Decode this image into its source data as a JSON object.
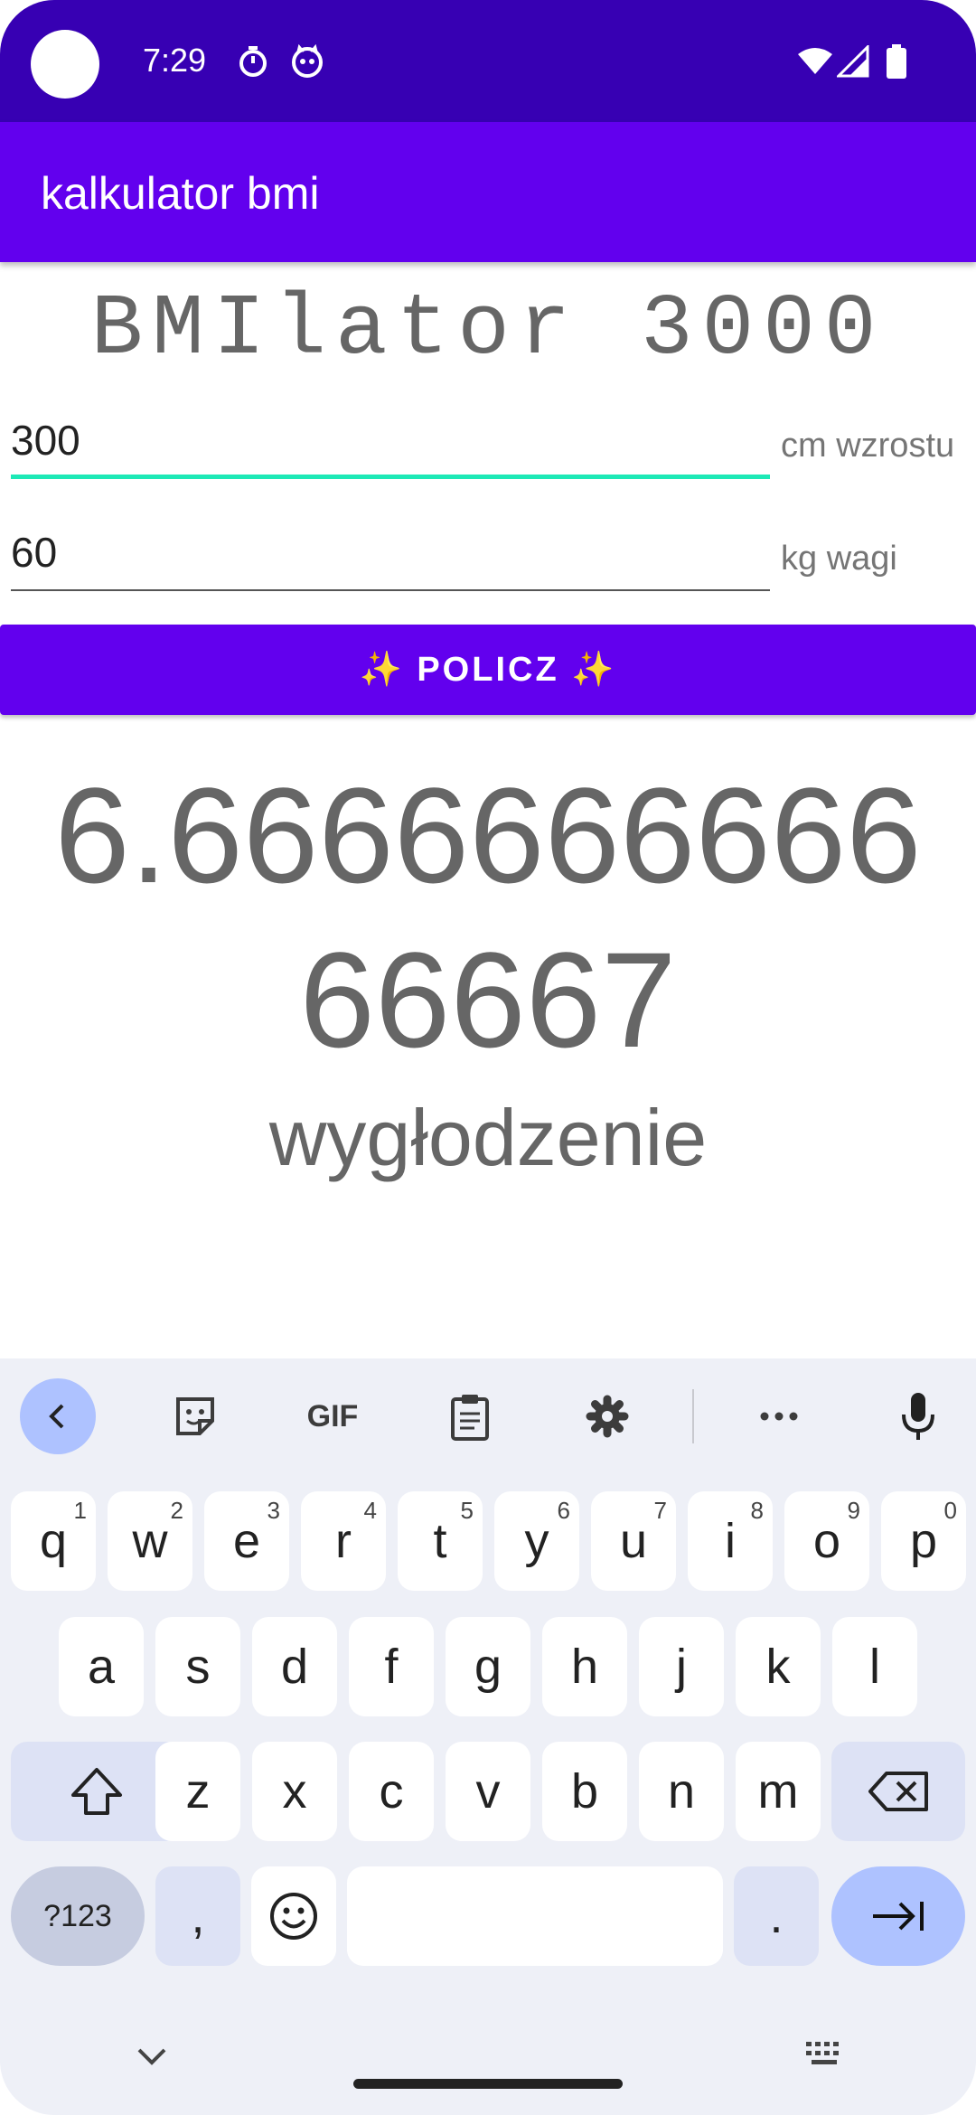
{
  "status_bar": {
    "time": "7:29"
  },
  "app_bar": {
    "title": "kalkulator bmi"
  },
  "headline": "BMIlator 3000",
  "height_field": {
    "value": "300",
    "label": "cm wzrostu"
  },
  "weight_field": {
    "value": "60",
    "label": "kg wagi"
  },
  "calc_button": {
    "label": "✨ POLICZ ✨"
  },
  "result": {
    "line1": "6.6666666666",
    "line2": "66667",
    "category": "wygłodzenie"
  },
  "keyboard": {
    "toolbar": [
      "back-icon",
      "sticker-icon",
      "gif-icon",
      "clipboard-icon",
      "gear-icon",
      "more-icon",
      "microphone-icon"
    ],
    "gif_label": "GIF",
    "row1": [
      {
        "key": "q",
        "sup": "1"
      },
      {
        "key": "w",
        "sup": "2"
      },
      {
        "key": "e",
        "sup": "3"
      },
      {
        "key": "r",
        "sup": "4"
      },
      {
        "key": "t",
        "sup": "5"
      },
      {
        "key": "y",
        "sup": "6"
      },
      {
        "key": "u",
        "sup": "7"
      },
      {
        "key": "i",
        "sup": "8"
      },
      {
        "key": "o",
        "sup": "9"
      },
      {
        "key": "p",
        "sup": "0"
      }
    ],
    "row2": [
      "a",
      "s",
      "d",
      "f",
      "g",
      "h",
      "j",
      "k",
      "l"
    ],
    "row3": [
      "z",
      "x",
      "c",
      "v",
      "b",
      "n",
      "m"
    ],
    "symbols_label": "?123",
    "comma": ",",
    "period": "."
  },
  "colors": {
    "status_bar": "#3700b3",
    "primary": "#6200ee",
    "accent": "#1de9b6",
    "keyboard_bg": "#eef0f7"
  }
}
